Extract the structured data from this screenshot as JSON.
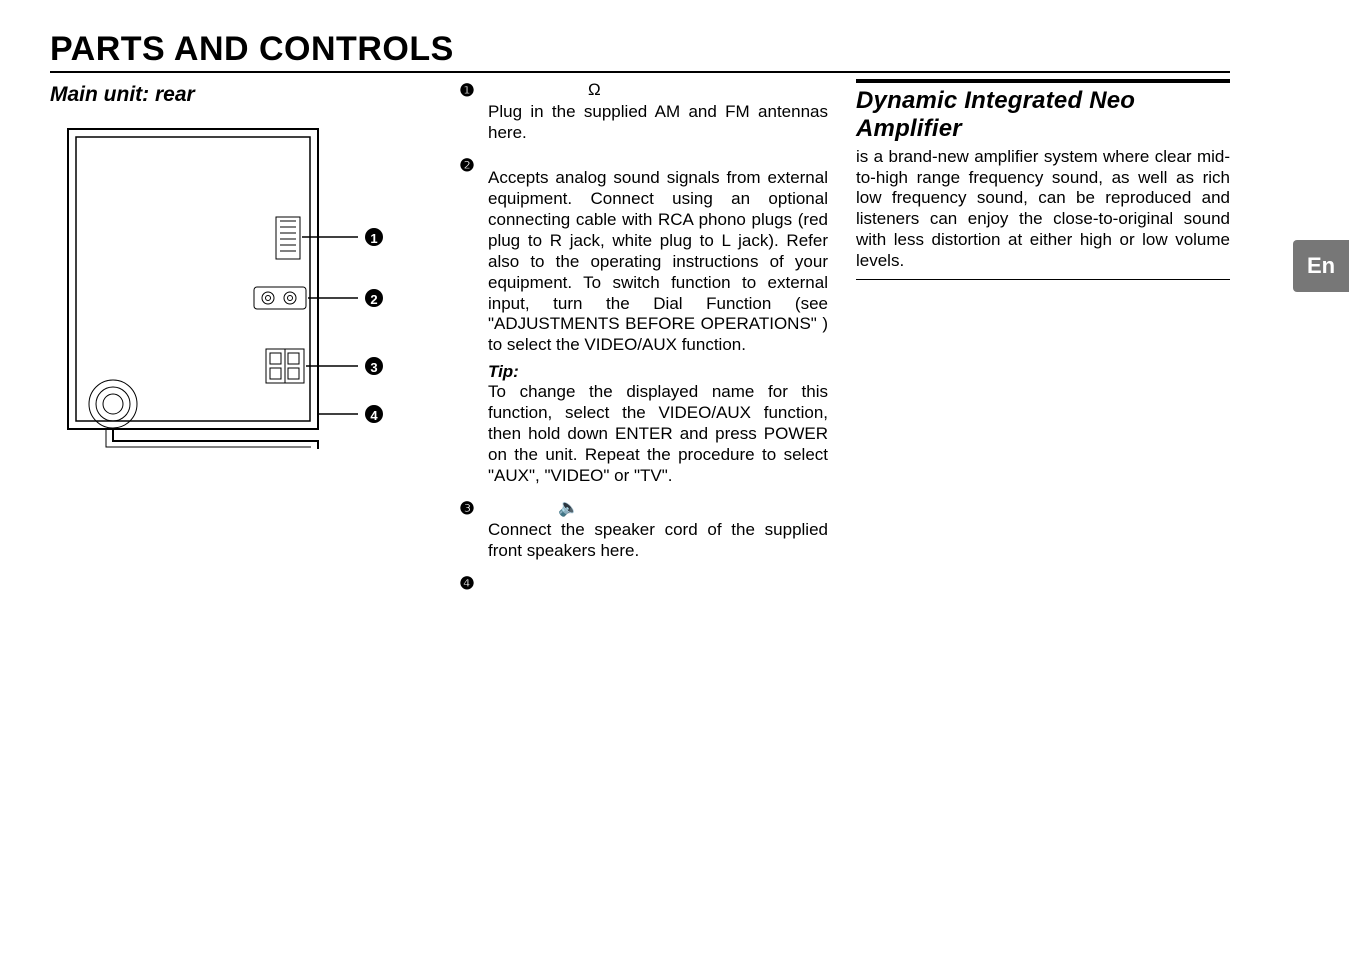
{
  "title": "PARTS AND CONTROLS",
  "left": {
    "subhead": "Main unit: rear",
    "callouts": [
      "1",
      "2",
      "3",
      "4"
    ]
  },
  "mid": {
    "items": [
      {
        "num": "❶",
        "hdr_glyph": "Ω",
        "desc": "Plug in the supplied AM and FM antennas here."
      },
      {
        "num": "❷",
        "desc": "Accepts analog sound signals from external equipment. Connect using an optional connecting cable with RCA phono plugs (red plug to R jack, white plug to L jack). Refer also to the operating instructions of your equipment. To switch function to external input, turn the Dial Function (see \"ADJUSTMENTS BEFORE OPERATIONS\" ) to select the VIDEO/AUX function.",
        "tip_label": "Tip:",
        "tip": "To change the displayed name for this function, select the VIDEO/AUX function, then hold down ENTER and press POWER on the unit. Repeat the procedure to select \"AUX\", \"VIDEO\" or \"TV\"."
      },
      {
        "num": "❸",
        "hdr_glyph": "🔈",
        "desc": "Connect the speaker cord of the supplied front speakers here."
      },
      {
        "num": "❹"
      }
    ]
  },
  "right": {
    "subhead": "Dynamic Integrated Neo Amplifier",
    "body": "is a brand-new amplifier system where clear mid-to-high range frequency sound, as well as rich low frequency sound, can be reproduced and listeners can enjoy the close-to-original sound with less distortion at either high or low volume levels."
  },
  "lang_tab": "En"
}
